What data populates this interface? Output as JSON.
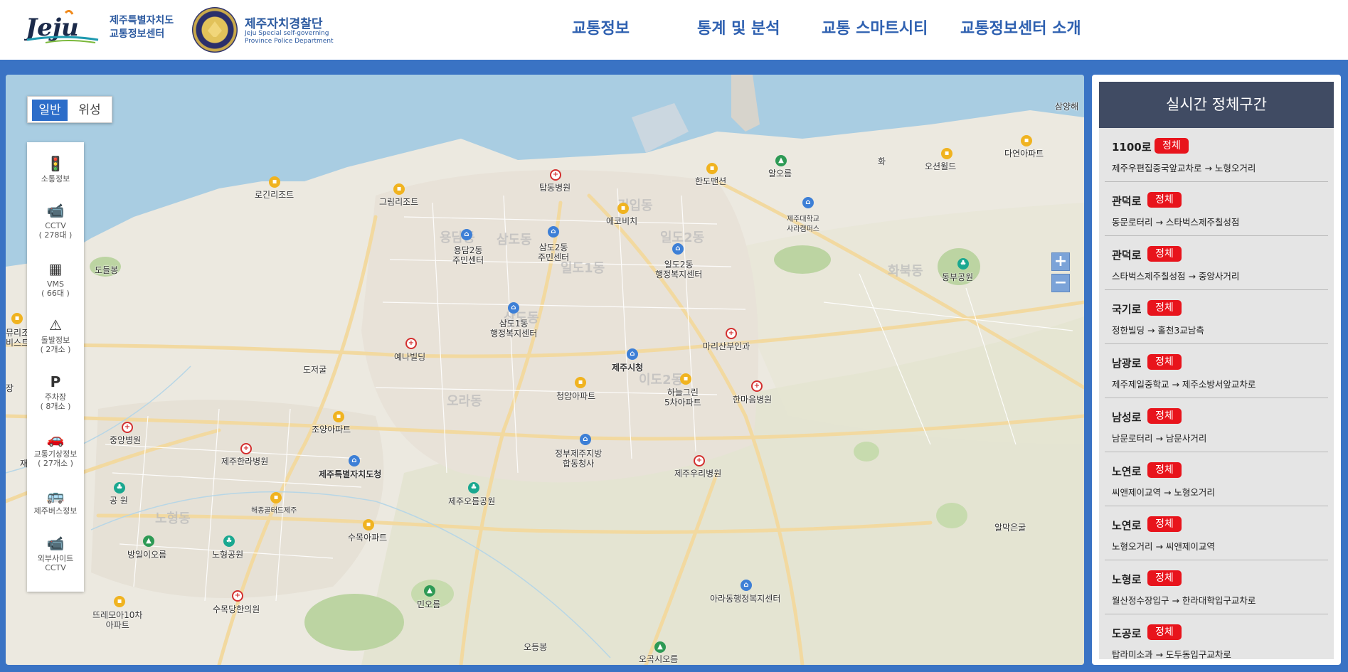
{
  "header": {
    "jeju_logo_text": "Jeju",
    "jeju_org_line1": "제주특별자치도",
    "jeju_org_line2": "교통정보센터",
    "police_title": "제주자치경찰단",
    "police_sub_line1": "Jeju Special self-governing",
    "police_sub_line2": "Province Police Department"
  },
  "nav": [
    "교통정보",
    "통계 및 분석",
    "교통 스마트시티",
    "교통정보센터 소개"
  ],
  "map": {
    "type_toggle": {
      "normal": "일반",
      "satellite": "위성",
      "selected": "일반"
    },
    "tools": [
      {
        "icon": "traffic-light-icon",
        "label1": "소통정보",
        "label2": ""
      },
      {
        "icon": "cctv-icon",
        "label1": "CCTV",
        "label2": "( 278대 )"
      },
      {
        "icon": "vms-icon",
        "label1": "VMS",
        "label2": "( 66대 )"
      },
      {
        "icon": "warning-icon",
        "label1": "돌발정보",
        "label2": "( 2개소 )"
      },
      {
        "icon": "parking-icon",
        "label1": "주차장",
        "label2": "( 8개소 )"
      },
      {
        "icon": "weather-car-icon",
        "label1": "교통기상정보",
        "label2": "( 27개소 )"
      },
      {
        "icon": "bus-icon",
        "label1": "제주버스정보",
        "label2": ""
      },
      {
        "icon": "external-cctv-icon",
        "label1": "외부사이트",
        "label2": "CCTV"
      }
    ],
    "zoom_in": "+",
    "zoom_out": "−",
    "places": {
      "p1": "탑동병원",
      "p2": "한도맨션",
      "p3": "알오름",
      "p4": "오션윌드",
      "p5": "다연아파트",
      "p6": "삼양해",
      "p7": "로긴리조트",
      "p8": "그림리조트",
      "p9": "에코비치",
      "p10": "제주대학교\n사라캠퍼스",
      "p11": "화",
      "p12": "용담2동\n주민센터",
      "p13": "삼도2동\n주민센터",
      "p14": "일도2동\n행정복지센터",
      "p15": "도들봉",
      "p16": "동부공원",
      "p17": "삼도1동\n행정복지센터",
      "p18": "마리산부인과",
      "p19": "예나빌딩",
      "p20": "도저굴",
      "p21": "제주시청",
      "p22": "청암아파트",
      "p23": "하늘그린\n5차아파트",
      "p24": "한마음병원",
      "p25": "중앙병원",
      "p26": "조양아파트",
      "p27": "제주한라병원",
      "p28": "정부제주지방\n합동청사",
      "p29": "제주특별자치도청",
      "p30": "제주우리병원",
      "p31": "공 원",
      "p32": "제주오름공원",
      "p33": "알막은굴",
      "p34": "해종골태드제주",
      "p35": "수목아파트",
      "p36": "방일이오름",
      "p37": "노형공원",
      "p38": "민오름",
      "p39": "아라동행정복지센터",
      "p40": "뜨레모아10차\n아파트",
      "p41": "수목당한의원",
      "p42": "오등봉",
      "p43": "오곡시오름",
      "p44": "비스트",
      "p45": "뮤리조",
      "p46": "재",
      "p47": "장"
    },
    "districts": [
      "용담동",
      "삼도동",
      "일도1동",
      "일도2동",
      "건입동",
      "이도2동",
      "오라동",
      "노형동",
      "삼도동",
      "화북동"
    ]
  },
  "panel": {
    "title": "실시간 정체구간",
    "items": [
      {
        "road": "1100로",
        "status": "정체",
        "route": "제주우편집중국앞교차로 → 노형오거리"
      },
      {
        "road": "관덕로",
        "status": "정체",
        "route": "동문로터리 → 스타벅스제주칠성점"
      },
      {
        "road": "관덕로",
        "status": "정체",
        "route": "스타벅스제주칠성점 → 중앙사거리"
      },
      {
        "road": "국기로",
        "status": "정체",
        "route": "정한빌딩 → 홀천3교남측"
      },
      {
        "road": "남광로",
        "status": "정체",
        "route": "제주제일중학교 → 제주소방서앞교차로"
      },
      {
        "road": "남성로",
        "status": "정체",
        "route": "남문로터리 → 남문사거리"
      },
      {
        "road": "노연로",
        "status": "정체",
        "route": "씨앤제이교역 → 노형오거리"
      },
      {
        "road": "노연로",
        "status": "정체",
        "route": "노형오거리 → 씨앤제이교역"
      },
      {
        "road": "노형로",
        "status": "정체",
        "route": "월산정수장입구 → 한라대학입구교차로"
      },
      {
        "road": "도공로",
        "status": "정체",
        "route": "탑라미소과 → 도두동입구교차로"
      }
    ]
  },
  "colors": {
    "header_bg": "#ffffff",
    "frame_blue": "#3a73c4",
    "panel_head": "#404b63",
    "badge_red": "#e8141c",
    "nav_blue": "#2e60b0"
  }
}
